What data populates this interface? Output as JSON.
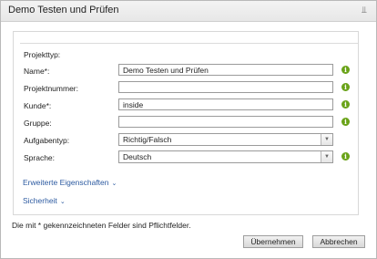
{
  "dialog": {
    "title": "Demo Testen und Prüfen",
    "pin_icon": "pin-icon"
  },
  "form": {
    "section_label": "Projekttyp:",
    "name": {
      "label": "Name*:",
      "value": "Demo Testen und Prüfen"
    },
    "projektnummer": {
      "label": "Projektnummer:",
      "value": ""
    },
    "kunde": {
      "label": "Kunde*:",
      "value": "inside"
    },
    "gruppe": {
      "label": "Gruppe:",
      "value": ""
    },
    "aufgabentyp": {
      "label": "Aufgabentyp:",
      "value": "Richtig/Falsch"
    },
    "sprache": {
      "label": "Sprache:",
      "value": "Deutsch"
    },
    "info_icon": "i",
    "erweiterte_link": "Erweiterte Eigenschaften",
    "sicherheit_link": "Sicherheit"
  },
  "footer": {
    "note": "Die mit * gekennzeichneten Felder sind Pflichtfelder.",
    "ok_label": "Übernehmen",
    "cancel_label": "Abbrechen"
  },
  "colors": {
    "info": "#6aa319",
    "link": "#2c5aa0"
  }
}
